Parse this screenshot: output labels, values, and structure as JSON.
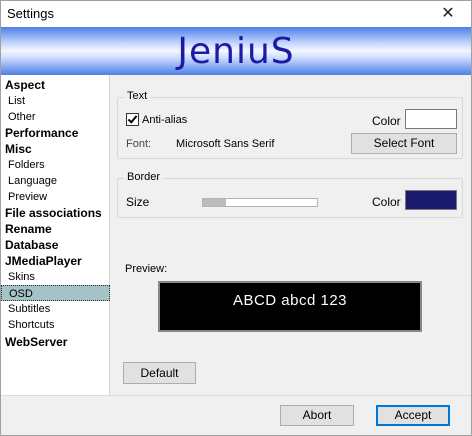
{
  "window": {
    "title": "Settings",
    "close_glyph": "✕"
  },
  "banner": {
    "text": "JeniuS"
  },
  "sidebar": {
    "items": [
      {
        "label": "Aspect",
        "level": "top"
      },
      {
        "label": "List",
        "level": "sub"
      },
      {
        "label": "Other",
        "level": "sub"
      },
      {
        "label": "Performance",
        "level": "top"
      },
      {
        "label": "Misc",
        "level": "top"
      },
      {
        "label": "Folders",
        "level": "sub"
      },
      {
        "label": "Language",
        "level": "sub"
      },
      {
        "label": "Preview",
        "level": "sub"
      },
      {
        "label": "File associations",
        "level": "top"
      },
      {
        "label": "Rename",
        "level": "top"
      },
      {
        "label": "Database",
        "level": "top"
      },
      {
        "label": "JMediaPlayer",
        "level": "top"
      },
      {
        "label": "Skins",
        "level": "sub"
      },
      {
        "label": "OSD",
        "level": "sub",
        "selected": true
      },
      {
        "label": "Subtitles",
        "level": "sub"
      },
      {
        "label": "Shortcuts",
        "level": "sub"
      },
      {
        "label": "WebServer",
        "level": "top"
      }
    ]
  },
  "text_group": {
    "title": "Text",
    "antialias_label": "Anti-alias",
    "antialias_checked": true,
    "color_label": "Color",
    "text_color": "#ffffff",
    "font_label": "Font:",
    "font_value": "Microsoft Sans Serif",
    "select_font_label": "Select Font"
  },
  "border_group": {
    "title": "Border",
    "size_label": "Size",
    "size_fraction": 0.2,
    "color_label": "Color",
    "border_color": "#1a1a6e"
  },
  "preview": {
    "label": "Preview:",
    "sample_text": "ABCD abcd 123"
  },
  "buttons": {
    "default_label": "Default",
    "abort_label": "Abort",
    "accept_label": "Accept"
  }
}
